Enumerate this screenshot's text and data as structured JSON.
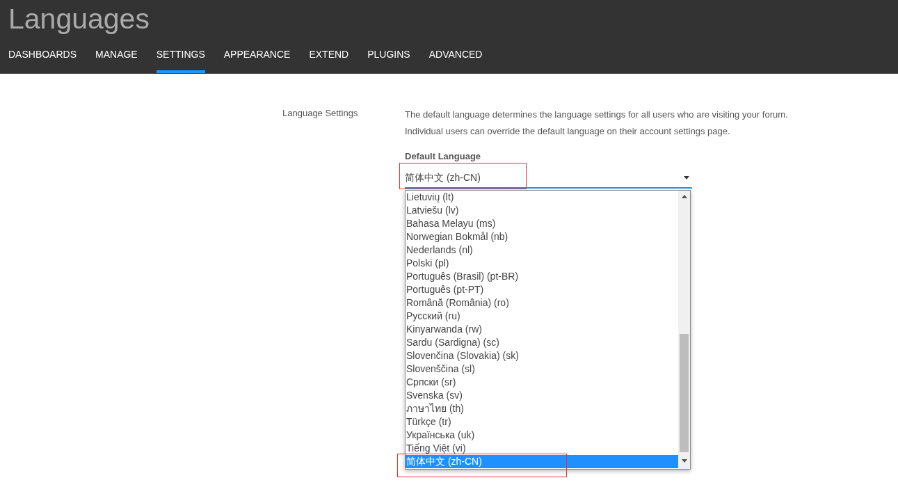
{
  "header": {
    "title": "Languages"
  },
  "tabs": [
    {
      "label": "DASHBOARDS",
      "selected": false
    },
    {
      "label": "MANAGE",
      "selected": false
    },
    {
      "label": "SETTINGS",
      "selected": true
    },
    {
      "label": "APPEARANCE",
      "selected": false
    },
    {
      "label": "EXTEND",
      "selected": false
    },
    {
      "label": "PLUGINS",
      "selected": false
    },
    {
      "label": "ADVANCED",
      "selected": false
    }
  ],
  "section": {
    "label": "Language Settings",
    "description": [
      "The default language determines the language settings for all users who are visiting your forum.",
      "Individual users can override the default language on their account settings page."
    ],
    "field": {
      "label": "Default Language",
      "value": "简体中文 (zh-CN)",
      "expanded": true,
      "annotated": true,
      "options": [
        {
          "label": "Lietuvių (lt)",
          "selected": false,
          "annotated": false
        },
        {
          "label": "Latviešu (lv)",
          "selected": false,
          "annotated": false
        },
        {
          "label": "Bahasa Melayu (ms)",
          "selected": false,
          "annotated": false
        },
        {
          "label": "Norwegian Bokmål (nb)",
          "selected": false,
          "annotated": false
        },
        {
          "label": "Nederlands (nl)",
          "selected": false,
          "annotated": false
        },
        {
          "label": "Polski (pl)",
          "selected": false,
          "annotated": false
        },
        {
          "label": "Português (Brasil) (pt-BR)",
          "selected": false,
          "annotated": false
        },
        {
          "label": "Português (pt-PT)",
          "selected": false,
          "annotated": false
        },
        {
          "label": "Română (România) (ro)",
          "selected": false,
          "annotated": false
        },
        {
          "label": "Русский (ru)",
          "selected": false,
          "annotated": false
        },
        {
          "label": "Kinyarwanda (rw)",
          "selected": false,
          "annotated": false
        },
        {
          "label": "Sardu (Sardigna) (sc)",
          "selected": false,
          "annotated": false
        },
        {
          "label": "Slovenčina (Slovakia) (sk)",
          "selected": false,
          "annotated": false
        },
        {
          "label": "Slovenščina (sl)",
          "selected": false,
          "annotated": false
        },
        {
          "label": "Српски (sr)",
          "selected": false,
          "annotated": false
        },
        {
          "label": "Svenska (sv)",
          "selected": false,
          "annotated": false
        },
        {
          "label": "ภาษาไทย (th)",
          "selected": false,
          "annotated": false
        },
        {
          "label": "Türkçe (tr)",
          "selected": false,
          "annotated": false
        },
        {
          "label": "Українська (uk)",
          "selected": false,
          "annotated": false
        },
        {
          "label": "Tiếng Việt (vi)",
          "selected": false,
          "annotated": false
        },
        {
          "label": "简体中文 (zh-CN)",
          "selected": true,
          "annotated": true
        }
      ]
    }
  }
}
